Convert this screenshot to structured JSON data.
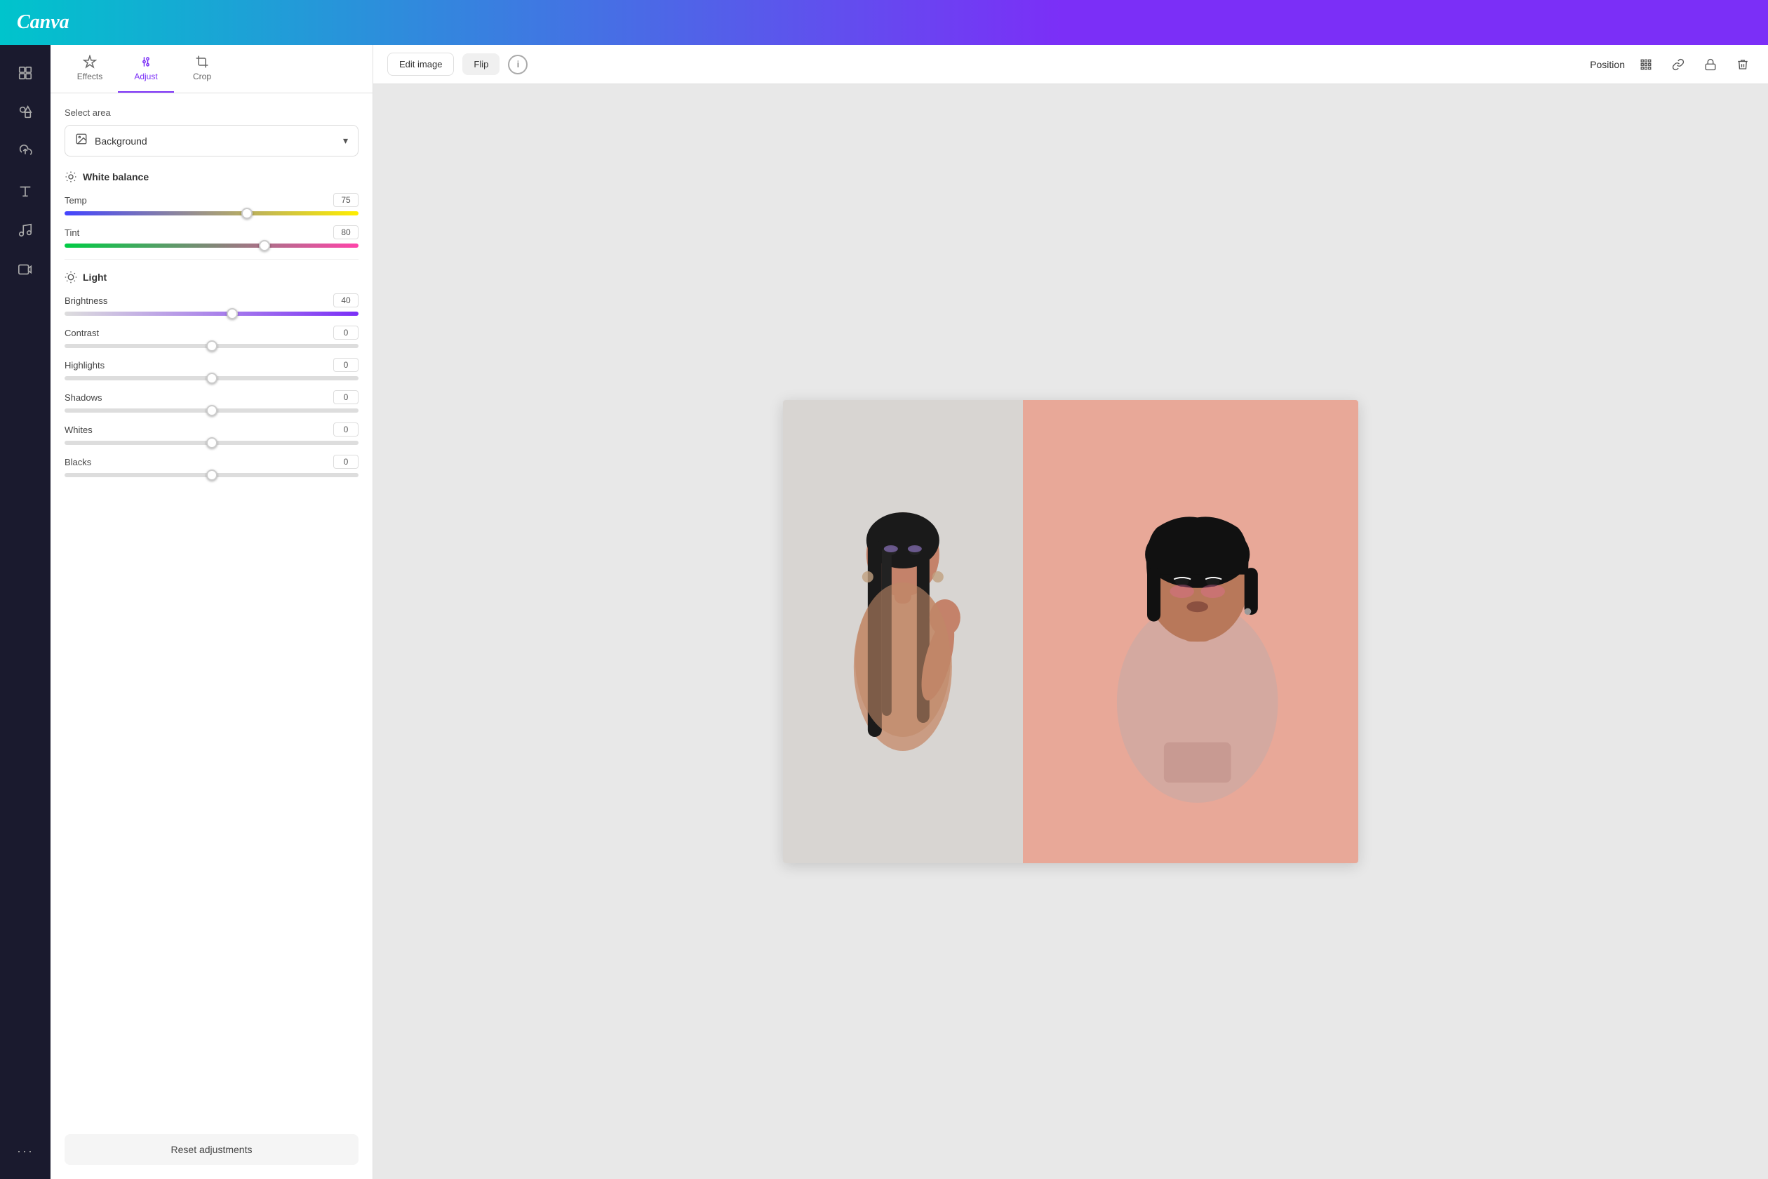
{
  "app": {
    "logo": "Canva"
  },
  "toolbar": {
    "edit_image_label": "Edit image",
    "flip_label": "Flip",
    "position_label": "Position",
    "info_symbol": "i"
  },
  "sidebar_icons": {
    "layout": "⊞",
    "elements": "◈",
    "upload": "⬆",
    "text": "T",
    "music": "♪",
    "video": "▶",
    "more": "···"
  },
  "panel": {
    "tabs": [
      {
        "id": "effects",
        "label": "Effects"
      },
      {
        "id": "adjust",
        "label": "Adjust"
      },
      {
        "id": "crop",
        "label": "Crop"
      }
    ],
    "active_tab": "adjust",
    "select_area_label": "Select area",
    "dropdown_value": "Background",
    "sections": {
      "white_balance": {
        "title": "White balance",
        "sliders": [
          {
            "id": "temp",
            "label": "Temp",
            "value": "75",
            "percent": 62
          },
          {
            "id": "tint",
            "label": "Tint",
            "value": "80",
            "percent": 68
          }
        ]
      },
      "light": {
        "title": "Light",
        "sliders": [
          {
            "id": "brightness",
            "label": "Brightness",
            "value": "40",
            "percent": 57
          },
          {
            "id": "contrast",
            "label": "Contrast",
            "value": "0",
            "percent": 50
          },
          {
            "id": "highlights",
            "label": "Highlights",
            "value": "0",
            "percent": 50
          },
          {
            "id": "shadows",
            "label": "Shadows",
            "value": "0",
            "percent": 50
          },
          {
            "id": "whites",
            "label": "Whites",
            "value": "0",
            "percent": 50
          },
          {
            "id": "blacks",
            "label": "Blacks",
            "value": "0",
            "percent": 50
          }
        ]
      }
    },
    "reset_label": "Reset adjustments"
  }
}
